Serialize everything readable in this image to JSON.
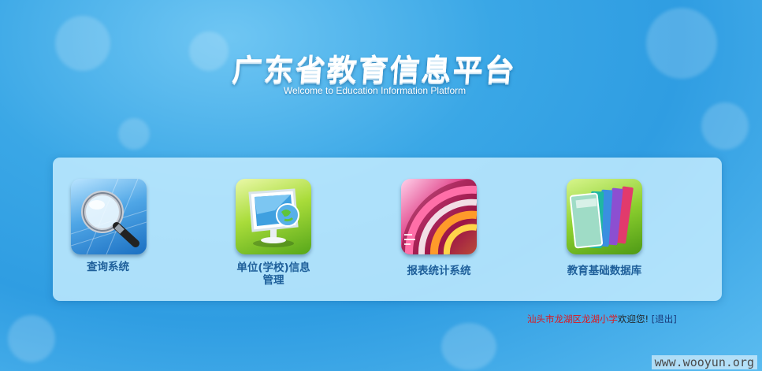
{
  "header": {
    "title": "广东省教育信息平台",
    "subtitle": "Welcome to Education Information Platform"
  },
  "tiles": [
    {
      "label": "查询系统",
      "icon": "magnifier-icon"
    },
    {
      "label_line1": "单位(学校)信息",
      "label_line2": "管理",
      "icon": "monitor-globe-icon"
    },
    {
      "label": "报表统计系统",
      "icon": "chart-icon"
    },
    {
      "label": "教育基础数据库",
      "icon": "books-icon"
    }
  ],
  "user": {
    "school": "汕头市龙湖区龙湖小学",
    "welcome": "欢迎您!",
    "logout": "[退出]"
  },
  "watermark": "www.wooyun.org",
  "colors": {
    "tile_label": "#1e5f9a",
    "school_name": "#e0151b",
    "panel": "#c8eeff"
  }
}
